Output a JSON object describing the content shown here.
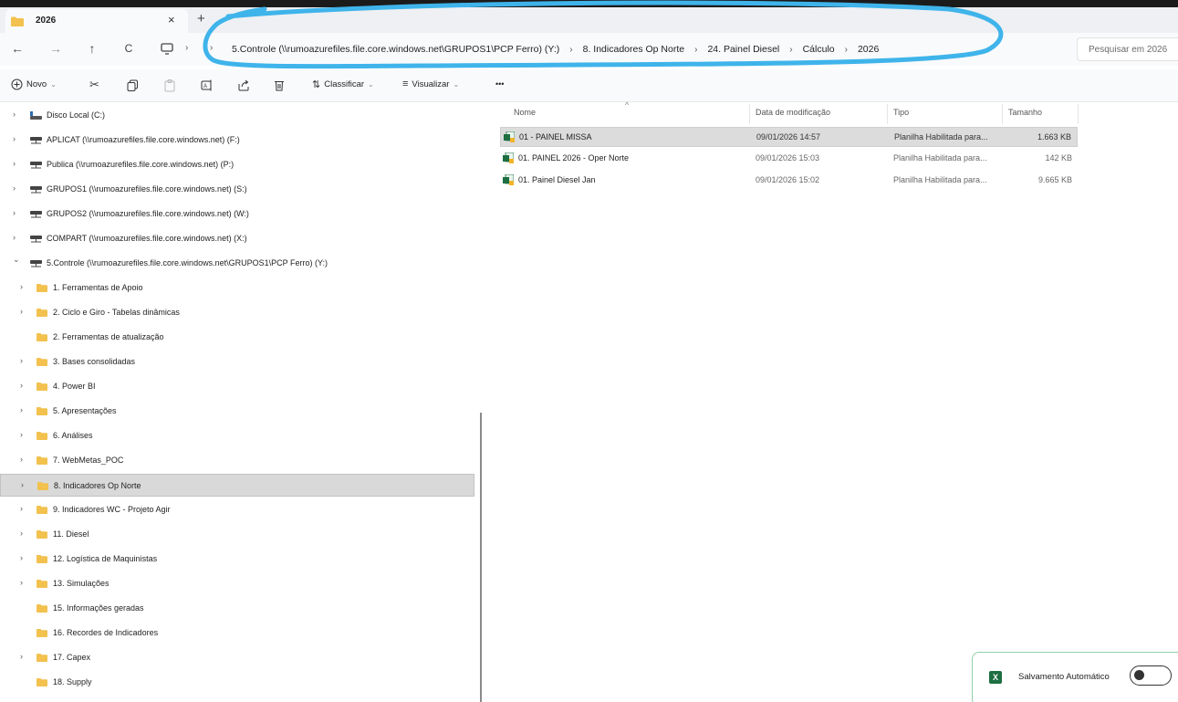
{
  "tab": {
    "title": "2026",
    "close": "×",
    "new": "+"
  },
  "nav": {
    "back": "←",
    "forward": "→",
    "up": "↑",
    "refresh": "C"
  },
  "breadcrumbs": [
    "5.Controle (\\\\rumoazurefiles.file.core.windows.net\\GRUPOS1\\PCP Ferro) (Y:)",
    "8. Indicadores Op Norte",
    "24. Painel Diesel",
    "Cálculo",
    "2026"
  ],
  "search": {
    "placeholder": "Pesquisar em 2026"
  },
  "toolbar": {
    "new_label": "Novo",
    "sort_label": "Classificar",
    "view_label": "Visualizar",
    "more_label": "•••"
  },
  "tree": [
    {
      "label": "Disco Local (C:)",
      "type": "drive",
      "chevron": "›",
      "indent": 0
    },
    {
      "label": "APLICAT (\\\\rumoazurefiles.file.core.windows.net) (F:)",
      "type": "net",
      "chevron": "›",
      "indent": 0
    },
    {
      "label": "Publica (\\\\rumoazurefiles.file.core.windows.net) (P:)",
      "type": "net",
      "chevron": "›",
      "indent": 0
    },
    {
      "label": "GRUPOS1 (\\\\rumoazurefiles.file.core.windows.net) (S:)",
      "type": "net",
      "chevron": "›",
      "indent": 0
    },
    {
      "label": "GRUPOS2 (\\\\rumoazurefiles.file.core.windows.net) (W:)",
      "type": "net",
      "chevron": "›",
      "indent": 0
    },
    {
      "label": "COMPART (\\\\rumoazurefiles.file.core.windows.net) (X:)",
      "type": "net",
      "chevron": "›",
      "indent": 0
    },
    {
      "label": "5.Controle (\\\\rumoazurefiles.file.core.windows.net\\GRUPOS1\\PCP Ferro) (Y:)",
      "type": "net",
      "chevron": "⌄",
      "indent": 0
    },
    {
      "label": "1. Ferramentas de Apoio",
      "type": "folder",
      "chevron": "›",
      "indent": 1
    },
    {
      "label": "2. Ciclo e Giro - Tabelas dinâmicas",
      "type": "folder",
      "chevron": "›",
      "indent": 1
    },
    {
      "label": "2. Ferramentas de atualização",
      "type": "folder",
      "chevron": "",
      "indent": 1
    },
    {
      "label": "3. Bases consolidadas",
      "type": "folder",
      "chevron": "›",
      "indent": 1
    },
    {
      "label": "4. Power BI",
      "type": "folder",
      "chevron": "›",
      "indent": 1
    },
    {
      "label": "5. Apresentações",
      "type": "folder",
      "chevron": "›",
      "indent": 1
    },
    {
      "label": "6. Análises",
      "type": "folder",
      "chevron": "›",
      "indent": 1
    },
    {
      "label": "7. WebMetas_POC",
      "type": "folder",
      "chevron": "›",
      "indent": 1
    },
    {
      "label": "8. Indicadores Op Norte",
      "type": "folder",
      "chevron": "›",
      "indent": 1,
      "selected": true
    },
    {
      "label": "9. Indicadores WC - Projeto Agir",
      "type": "folder",
      "chevron": "›",
      "indent": 1
    },
    {
      "label": "11. Diesel",
      "type": "folder",
      "chevron": "›",
      "indent": 1
    },
    {
      "label": "12. Logística de  Maquinistas",
      "type": "folder",
      "chevron": "›",
      "indent": 1
    },
    {
      "label": "13. Simulações",
      "type": "folder",
      "chevron": "›",
      "indent": 1
    },
    {
      "label": "15. Informações geradas",
      "type": "folder",
      "chevron": "",
      "indent": 1
    },
    {
      "label": "16. Recordes de Indicadores",
      "type": "folder",
      "chevron": "",
      "indent": 1
    },
    {
      "label": "17. Capex",
      "type": "folder",
      "chevron": "›",
      "indent": 1
    },
    {
      "label": "18. Supply",
      "type": "folder",
      "chevron": "",
      "indent": 1
    }
  ],
  "columns": {
    "name": "Nome",
    "modified": "Data de modificação",
    "type": "Tipo",
    "size": "Tamanho"
  },
  "files": [
    {
      "name": "01 - PAINEL MISSA",
      "modified": "09/01/2026 14:57",
      "type": "Planilha Habilitada para...",
      "size": "1.663 KB",
      "selected": true
    },
    {
      "name": "01. PAINEL 2026 - Oper Norte",
      "modified": "09/01/2026 15:03",
      "type": "Planilha Habilitada para...",
      "size": "142 KB"
    },
    {
      "name": "01. Painel Diesel Jan",
      "modified": "09/01/2026 15:02",
      "type": "Planilha Habilitada para...",
      "size": "9.665 KB"
    }
  ],
  "toast": {
    "label": "Salvamento Automático",
    "app_icon": "X",
    "autosave_on": false
  },
  "colors": {
    "annotation": "#3fb4ea",
    "folder": "#f2c14e",
    "excel": "#1d6f42",
    "selection": "#d9d9d9"
  }
}
